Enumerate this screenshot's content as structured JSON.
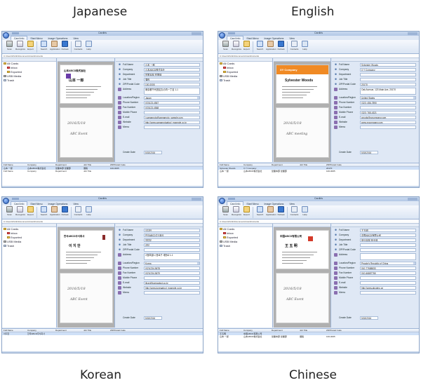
{
  "captions": {
    "japanese": "Japanese",
    "english": "English",
    "korean": "Korean",
    "chinese": "Chinese"
  },
  "common": {
    "window_title": "Cardiris",
    "tabs": [
      "Card Info",
      "Start Menu",
      "Image Operations",
      "View"
    ],
    "ribbon_buttons": [
      "Scan",
      "Recognize",
      "Export",
      "Search",
      "Application",
      "Outlook",
      "Contacts",
      "Help"
    ],
    "tree": {
      "all_cards": "All Cards",
      "inbox": "Inbox",
      "exported": "Exported",
      "usb": "USB Media",
      "trash": "Trash"
    },
    "list_headers": [
      "Full Name",
      "Company",
      "Department",
      "Job Title",
      "ZIP/Postal Code"
    ],
    "create_date_label": "Create Date",
    "date_value": "5/18/2016",
    "address_path": "C:\\Users\\Public\\Documents\\Cardiris\\cards"
  },
  "field_labels": {
    "ja": [
      "Full Name",
      "Company",
      "Department",
      "Job Title",
      "ZIP/Postal Code",
      "Address",
      "Location/Region",
      "Phone Number",
      "Fax Number",
      "Mobile Phone",
      "E-mail",
      "Website",
      "Memo"
    ],
    "en": [
      "Full Name",
      "Company",
      "Department",
      "Job Title",
      "ZIP/Postal Code",
      "Address",
      "Location/Region",
      "Phone Number",
      "Fax Number",
      "Mobile Phone",
      "E-mail",
      "Website",
      "Memo"
    ],
    "ko": [
      "Full Name",
      "Company",
      "Department",
      "Job Title",
      "ZIP/Postal Code",
      "Address",
      "Location/Region",
      "Phone Number",
      "Fax Number",
      "Mobile Phone",
      "E-mail",
      "Website",
      "Memo"
    ],
    "zh": [
      "Full Name",
      "Company",
      "Department",
      "Job Title",
      "ZIP/Postal Code",
      "Address",
      "Location/Region",
      "Phone Number",
      "Fax Number",
      "Mobile Phone",
      "E-mail",
      "Website",
      "Memo"
    ]
  },
  "panels": {
    "ja": {
      "card_company": "山本ABCD株式会社",
      "card_name": "山本 一郎",
      "scribble1": "2016/5/18",
      "scribble2": "ABC Event",
      "values": [
        "山本 一郎",
        "山本ABCD株式会社",
        "営業本部 営業部",
        "課長",
        "100-0005",
        "東京都千代田区丸の内一丁目 1-1",
        "Japan",
        "(03)123-4567",
        "(03)123-4568",
        "",
        "i.yamamoto@yamamoto_sample.com",
        "http://www.yamamotoabcd_example.co.jp",
        ""
      ],
      "rows": [
        [
          "山本 一郎",
          "山本ABCD株式会社",
          "営業本部 営業部",
          "課長",
          "100-0005"
        ],
        [
          "Full Name",
          "Company",
          "Department",
          "Job Title",
          ""
        ]
      ]
    },
    "en": {
      "card_company": "XY Company",
      "card_name": "Sylvester Woods",
      "scribble1": "2016/5/18",
      "scribble2": "ABC meeting",
      "values": [
        "Sylvester Woods",
        "X Y Company",
        "",
        "",
        "20170",
        "Oak Avenue, 123 Main Ave, 20170",
        "United States",
        "(321) 456-7890",
        "",
        "(321) 765-4321",
        "woods@xycompany.com",
        "www.xycompany.com",
        ""
      ],
      "rows": [
        [
          "Sylvester Woods",
          "X Y Company",
          "",
          "",
          "20170"
        ],
        [
          "山本 一郎",
          "山本ABCD株式会社",
          "営業本部 営業部",
          "",
          "100-0005"
        ]
      ]
    },
    "ko": {
      "card_company": "한국ABCD주식회사",
      "card_name": "이 지 한",
      "scribble1": "2016/5/18",
      "scribble2": "ABC Event",
      "values": [
        "이지한",
        "한국ABCD주식회사",
        "영업부",
        "과장",
        "",
        "서울특별시 종로구 세종로 1-1",
        "Korea",
        "(02)1234-5678",
        "(02)1234-5679",
        "",
        "jihan@koreaabcd.co.kr",
        "http://www.koreaabcd_example.co.kr",
        ""
      ],
      "rows": [
        [
          "이지한",
          "한국ABCD주식회사",
          "",
          "",
          ""
        ]
      ]
    },
    "zh": {
      "card_company": "中国ABCD有限公司",
      "card_name": "王 五 明",
      "scribble1": "2016/5/18",
      "scribble2": "ABC Event",
      "values": [
        "王五明",
        "中国ABCD有限公司",
        "营业本部 营业部",
        "",
        "",
        "",
        "People's Republic of China",
        "010-77658833",
        "010-66887755",
        "",
        "",
        "http://www.abcdmo.cn",
        ""
      ],
      "rows": [
        [
          "王五明",
          "中国ABCD有限公司",
          "",
          "",
          ""
        ],
        [
          "山本 一郎",
          "山本ABCD株式会社",
          "営業本部 営業部",
          "課長",
          "100-0005"
        ]
      ]
    }
  }
}
